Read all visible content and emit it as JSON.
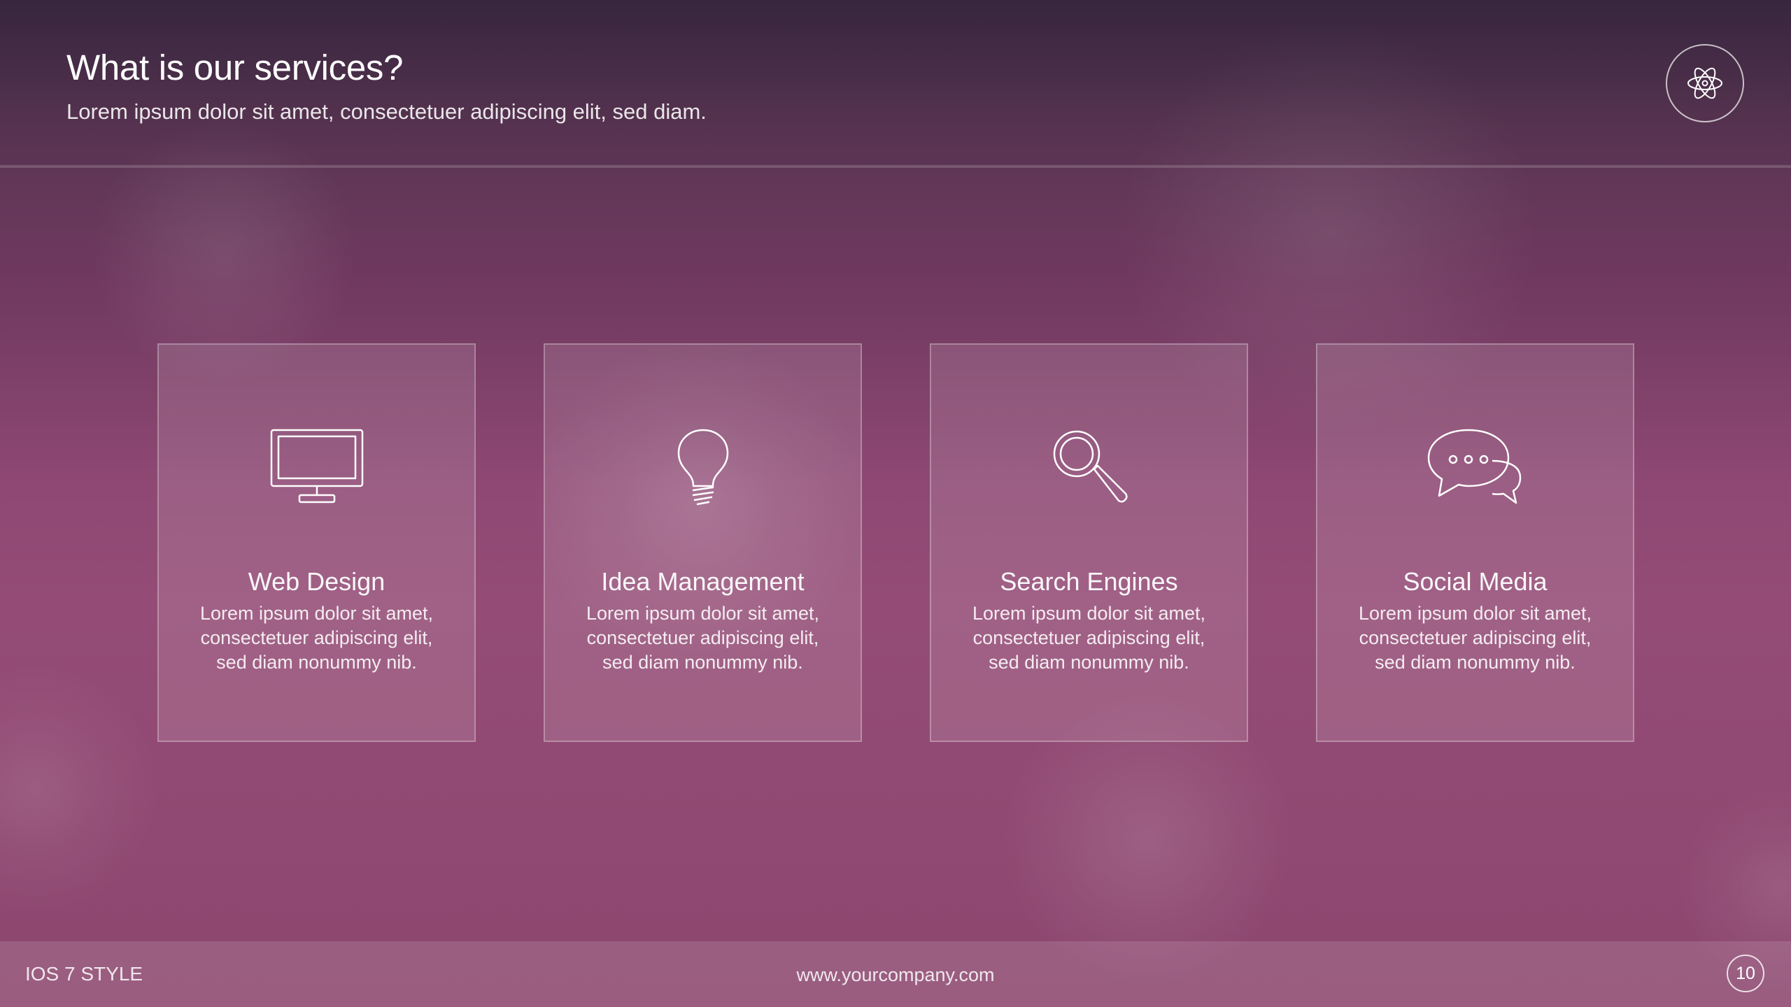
{
  "header": {
    "title": "What is our services?",
    "subtitle": "Lorem ipsum dolor sit amet, consectetuer adipiscing elit, sed diam.",
    "badge_icon": "atom-icon"
  },
  "services": [
    {
      "icon": "monitor-icon",
      "title": "Web Design",
      "lines": [
        "Lorem ipsum dolor sit amet,",
        "consectetuer adipiscing elit,",
        "sed diam nonummy nib."
      ]
    },
    {
      "icon": "lightbulb-icon",
      "title": "Idea Management",
      "lines": [
        "Lorem ipsum dolor sit amet,",
        "consectetuer adipiscing elit,",
        "sed diam nonummy nib."
      ]
    },
    {
      "icon": "magnifier-icon",
      "title": "Search Engines",
      "lines": [
        "Lorem ipsum dolor sit amet,",
        "consectetuer adipiscing elit,",
        "sed diam nonummy nib."
      ]
    },
    {
      "icon": "chat-bubbles-icon",
      "title": "Social Media",
      "lines": [
        "Lorem ipsum dolor sit amet,",
        "consectetuer adipiscing elit,",
        "sed diam nonummy nib."
      ]
    }
  ],
  "footer": {
    "label": "IOS 7 STYLE",
    "url": "www.yourcompany.com",
    "page_number": "10"
  },
  "colors": {
    "header_dark": "#3c2a42",
    "background_mid": "#944c76",
    "text": "#ffffff"
  }
}
